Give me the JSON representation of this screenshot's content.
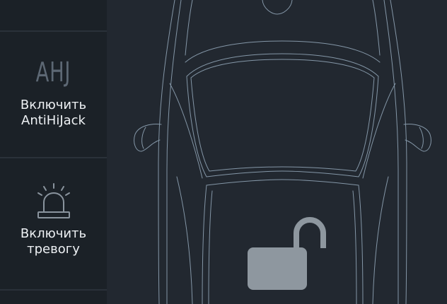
{
  "sidebar": {
    "antihijack": {
      "icon_text": "AHJ",
      "label_line1": "Включить",
      "label_line2": "AntiHiJack"
    },
    "alarm": {
      "icon": "siren-icon",
      "label_line1": "Включить",
      "label_line2": "тревогу"
    }
  },
  "car_view": {
    "lock_icon": "unlocked-padlock-icon",
    "lock_state": "unlocked"
  },
  "colors": {
    "background": "#222830",
    "sidebar": "#1b2127",
    "outline": "#8fa3b4",
    "lock": "#8e979f"
  }
}
